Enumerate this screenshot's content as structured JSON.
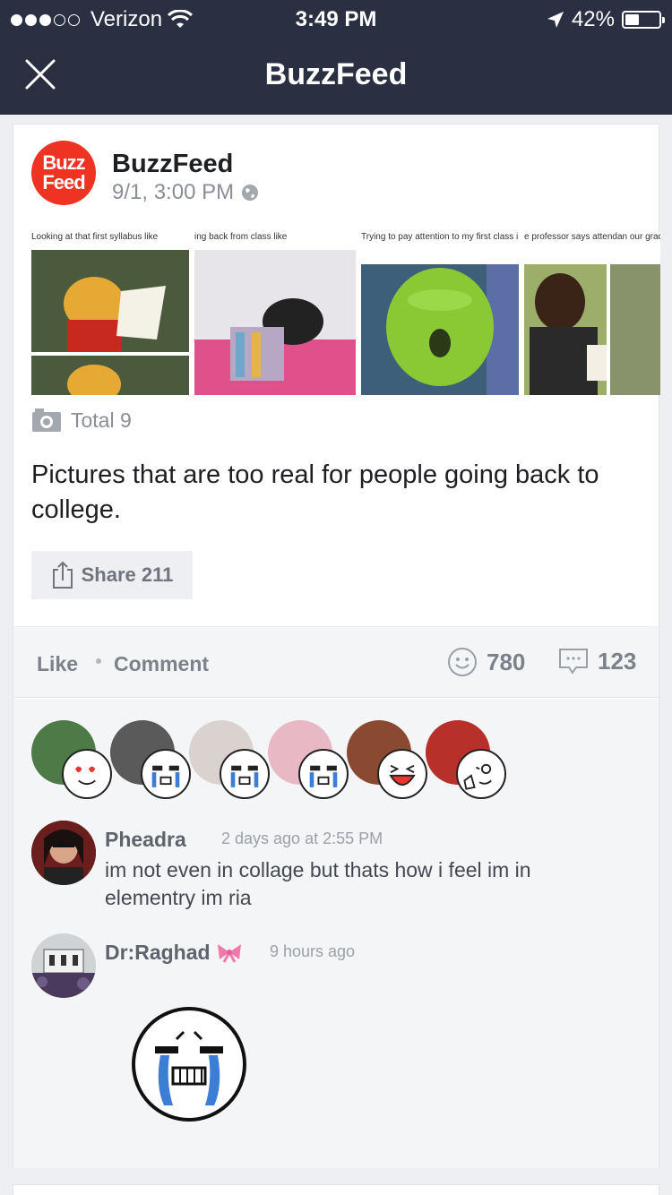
{
  "status_bar": {
    "carrier": "Verizon",
    "time": "3:49 PM",
    "battery": "42%",
    "battery_level": 0.42
  },
  "nav": {
    "title": "BuzzFeed",
    "close_icon": "close-icon"
  },
  "post": {
    "logo_line1": "Buzz",
    "logo_line2": "Feed",
    "author": "BuzzFeed",
    "timestamp": "9/1, 3:00 PM",
    "gallery": [
      {
        "caption": "Looking at that first syllabus like"
      },
      {
        "caption": "ing back from class like"
      },
      {
        "caption": "Trying to pay attention to my first class in the morning like"
      },
      {
        "caption": "e professor says attendan our grade"
      }
    ],
    "total_label": "Total 9",
    "text": "Pictures that are too real for people going back to college.",
    "share_label": "Share 211"
  },
  "actions": {
    "like": "Like",
    "comment": "Comment",
    "reaction_count": "780",
    "comment_count": "123"
  },
  "comments": [
    {
      "name": "Pheadra",
      "time": "2 days ago at 2:55 PM",
      "text": "im not even in collage but thats how i feel im in elementry im ria"
    },
    {
      "name": "Dr:Raghad",
      "time": "9 hours ago",
      "text": ""
    }
  ]
}
